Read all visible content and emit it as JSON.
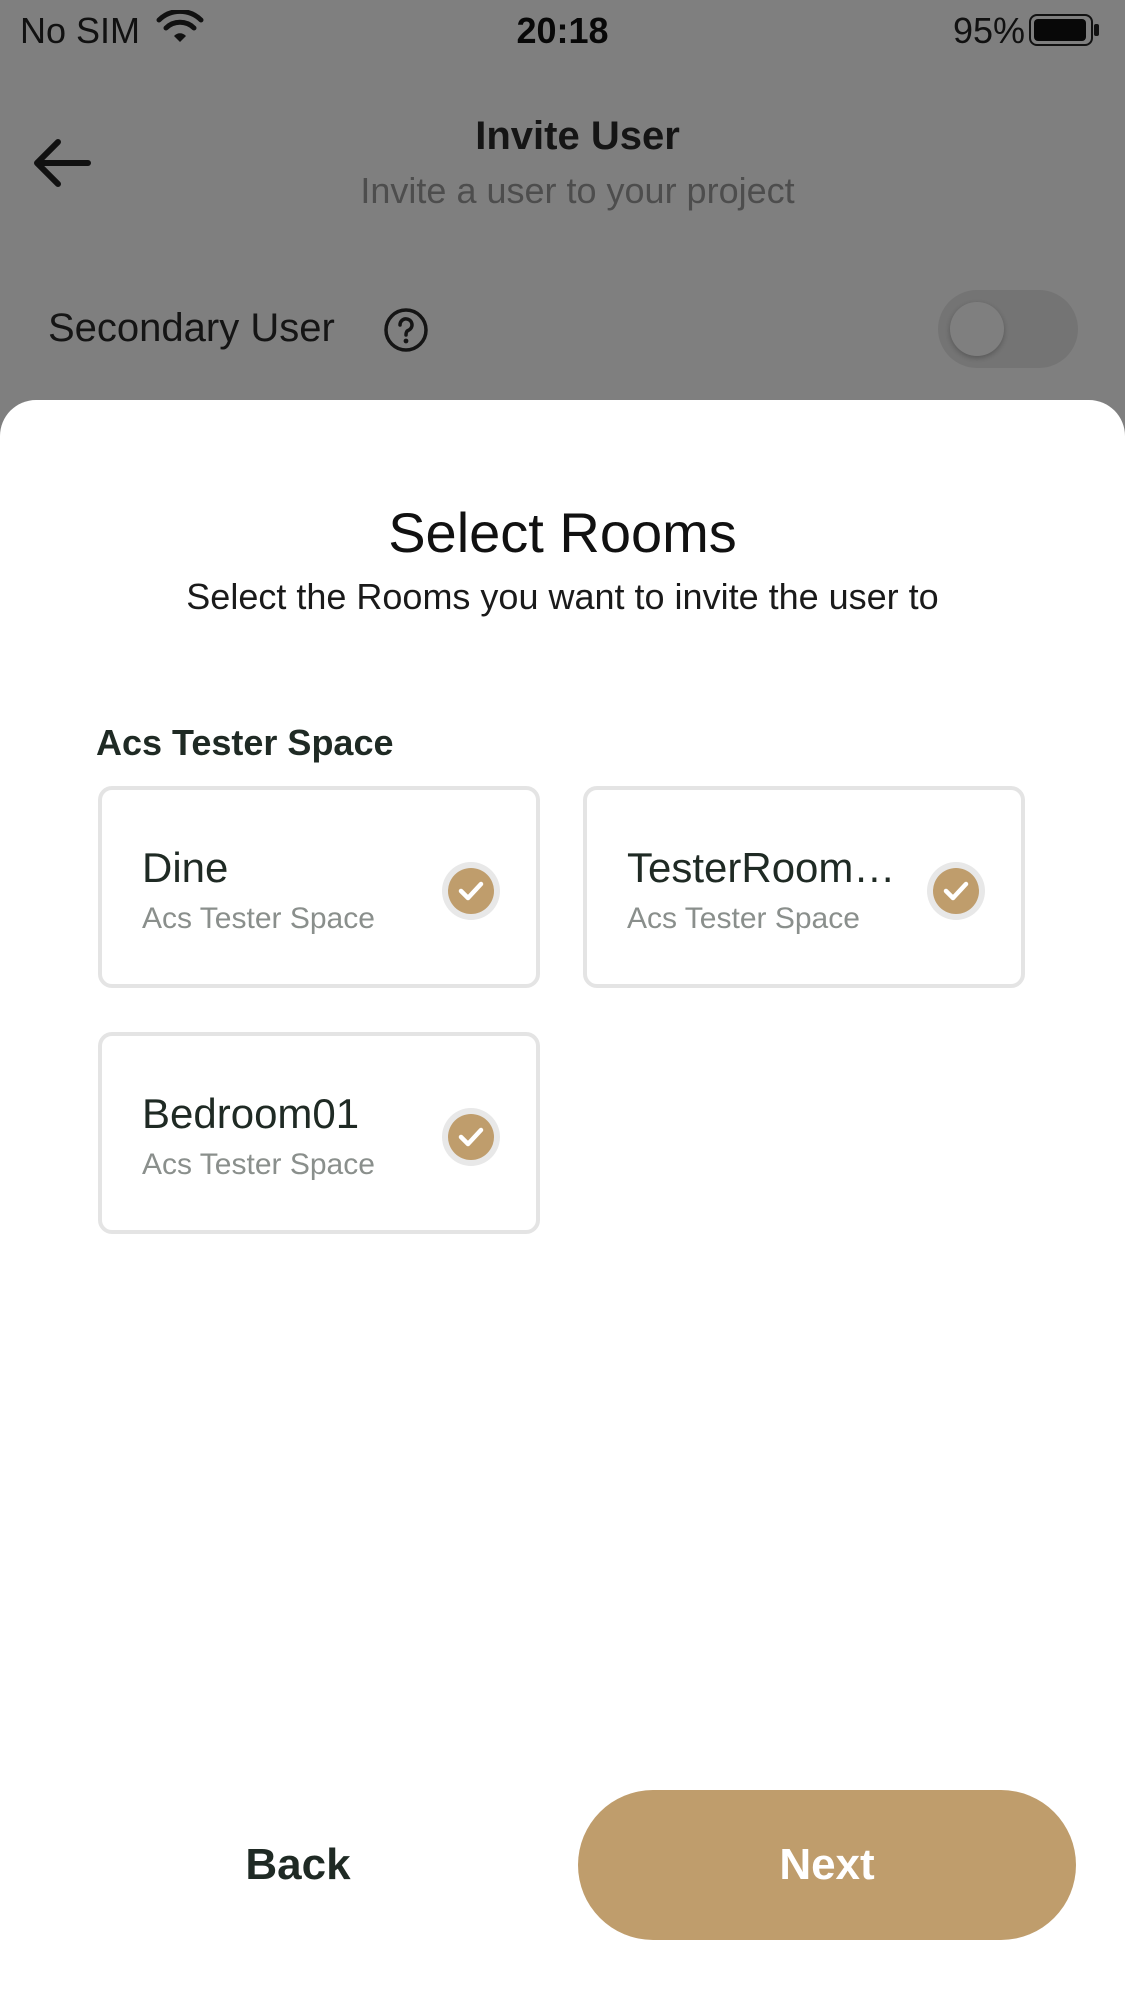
{
  "status_bar": {
    "carrier": "No SIM",
    "time": "20:18",
    "battery": "95%"
  },
  "header": {
    "title": "Invite User",
    "subtitle": "Invite a user to your project"
  },
  "secondary_user": {
    "label": "Secondary User",
    "toggle_on": false
  },
  "sheet": {
    "title": "Select Rooms",
    "subtitle": "Select the Rooms you want to invite the user to",
    "group_label": "Acs Tester Space",
    "rooms": [
      {
        "name": "Dine",
        "space": "Acs Tester Space",
        "selected": true
      },
      {
        "name": "TesterRoom…",
        "space": "Acs Tester Space",
        "selected": true
      },
      {
        "name": "Bedroom01",
        "space": "Acs Tester Space",
        "selected": true
      }
    ],
    "back_label": "Back",
    "next_label": "Next"
  },
  "colors": {
    "accent": "#bf9d6c",
    "check_bg": "#bf9d6c",
    "overlay": "rgba(0,0,0,0.5)"
  }
}
